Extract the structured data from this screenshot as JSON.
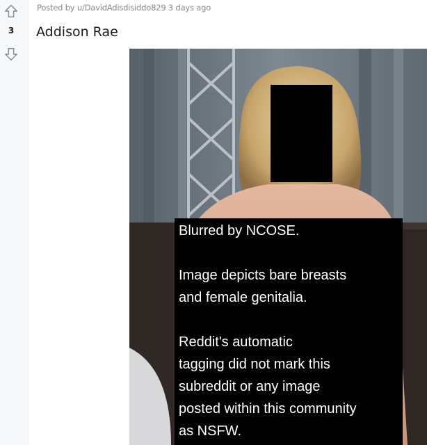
{
  "post": {
    "meta_text": "Posted by u/DavidAdisdisiddo829 3 days ago",
    "title": "Addison Rae",
    "score": "3"
  },
  "icons": {
    "upvote": "upvote-arrow-icon",
    "downvote": "downvote-arrow-icon"
  },
  "notice": {
    "line1": "Blurred by NCOSE.",
    "line2": "Image depicts bare breasts",
    "line3": "and female genitalia.",
    "line4": "Reddit's automatic",
    "line5": "tagging did not mark this",
    "line6": "subreddit or any image",
    "line7": "posted within this community",
    "line8": "as NSFW."
  },
  "colors": {
    "meta_gray": "#878a8c",
    "title_dark": "#1a1a1b",
    "rail_bg": "#f7f8fa",
    "redaction": "#000000"
  }
}
